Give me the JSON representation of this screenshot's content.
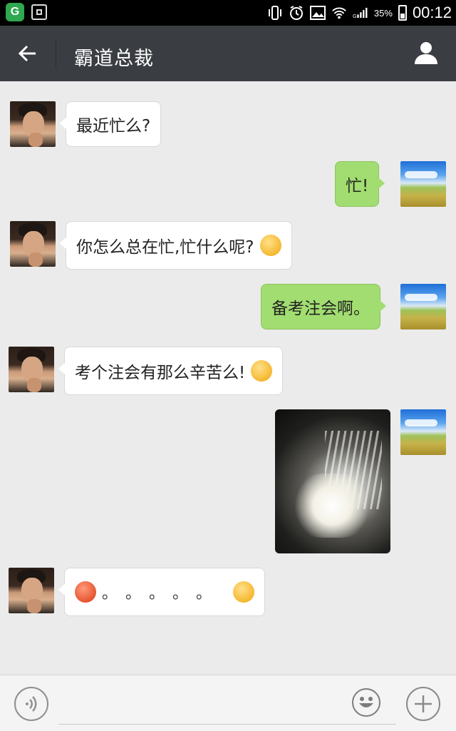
{
  "status_bar": {
    "battery_percent": "35%",
    "time": "00:12",
    "icons": [
      "app-badge-icon",
      "screenshot-icon",
      "vibrate-icon",
      "alarm-icon",
      "image-icon",
      "wifi-icon",
      "signal-icon",
      "battery-icon"
    ]
  },
  "header": {
    "title": "霸道总裁",
    "back_icon": "arrow-left-icon",
    "profile_icon": "person-icon"
  },
  "messages": [
    {
      "side": "in",
      "text": "最近忙么?",
      "emoji_after": null
    },
    {
      "side": "out",
      "text": "忙!",
      "emoji_after": null
    },
    {
      "side": "in",
      "text": "你怎么总在忙,忙什么呢?",
      "emoji_after": "grimace-emoji"
    },
    {
      "side": "out",
      "text": "备考注会啊。",
      "emoji_after": null
    },
    {
      "side": "in",
      "text": "考个注会有那么辛苦么!",
      "emoji_after": "smirk-emoji"
    },
    {
      "side": "out",
      "type": "image",
      "description_icon": "photo-of-pens"
    },
    {
      "side": "in",
      "text": "。。。。。",
      "emoji_before": "angry-emoji",
      "emoji_after": "thinking-emoji"
    }
  ],
  "input_bar": {
    "placeholder": "",
    "voice_icon": "voice-icon",
    "emoji_icon": "smiley-icon",
    "plus_icon": "plus-icon"
  },
  "colors": {
    "titlebar": "#3a3d42",
    "outgoing_bubble": "#a1dd70",
    "incoming_bubble": "#ffffff",
    "background": "#ebebeb"
  }
}
